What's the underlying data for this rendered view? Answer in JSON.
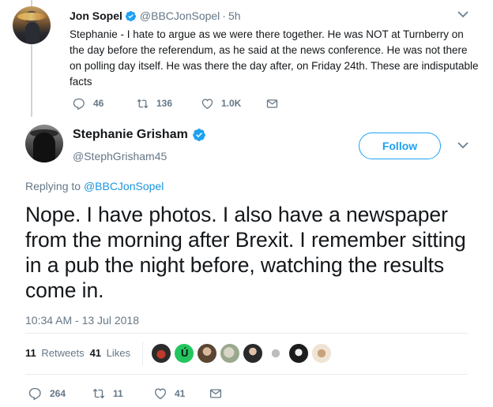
{
  "reply_tweet": {
    "name": "Jon Sopel",
    "handle": "@BBCJonSopel",
    "separator": "·",
    "time": "5h",
    "text": "Stephanie - I hate to argue as we were there together. He was NOT at Turnberry on the day before the referendum, as he said at the news conference. He was not there on polling day itself. He was there the day after, on Friday 24th. These are indisputable facts",
    "replies": "46",
    "retweets": "136",
    "likes": "1.0K"
  },
  "main_tweet": {
    "name": "Stephanie Grisham",
    "handle": "@StephGrisham45",
    "follow_label": "Follow",
    "replying_prefix": "Replying to",
    "replying_to": "@BBCJonSopel",
    "text": "Nope. I have photos. I also have a newspaper from the morning after Brexit. I remember sitting in a pub the night before, watching the results come in.",
    "timestamp": "10:34 AM - 13 Jul 2018",
    "retweets_count": "11",
    "retweets_label": "Retweets",
    "likes_count": "41",
    "likes_label": "Likes",
    "replies": "264",
    "retweets": "11",
    "likes": "41"
  },
  "icons": {
    "verified": "verified-badge-icon",
    "reply": "reply-icon",
    "retweet": "retweet-icon",
    "like": "heart-icon",
    "message": "direct-message-icon",
    "more": "chevron-down-icon"
  },
  "colors": {
    "accent": "#1da1f2",
    "text": "#14171a",
    "muted": "#657786",
    "link": "#1b95e0",
    "divider": "#e6ecf0"
  }
}
